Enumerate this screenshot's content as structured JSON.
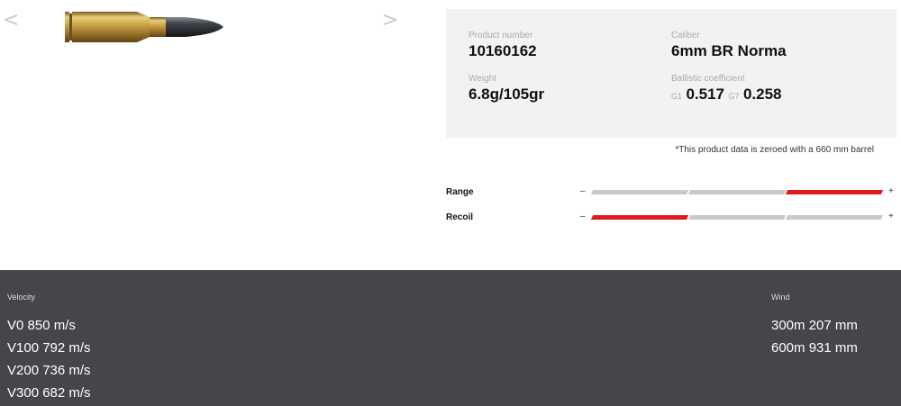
{
  "gallery": {
    "prev_glyph": "<",
    "next_glyph": ">",
    "image_icon": "cartridge-image"
  },
  "specs": {
    "product_number_label": "Product number",
    "product_number": "10160162",
    "caliber_label": "Caliber",
    "caliber": "6mm BR Norma",
    "weight_label": "Weight",
    "weight": "6.8g/105gr",
    "bc_label": "Ballistic coefficient",
    "bc_g1_prefix": "G1",
    "bc_g1": "0.517",
    "bc_g7_prefix": "G7",
    "bc_g7": "0.258",
    "note": "*This product data is zeroed with a 660 mm barrel"
  },
  "meters": {
    "range": {
      "label": "Range",
      "minus": "–",
      "plus": "+",
      "level": 3,
      "max": 3
    },
    "recoil": {
      "label": "Recoil",
      "minus": "–",
      "plus": "+",
      "level": 1,
      "max": 3
    },
    "active_color": "#e0191b",
    "inactive_color": "#c9c9c9"
  },
  "ballistics": {
    "velocity_heading": "Velocity",
    "velocity": [
      "V0 850 m/s",
      "V100 792 m/s",
      "V200 736 m/s",
      "V300 682 m/s"
    ],
    "wind_heading": "Wind",
    "wind": [
      "300m 207 mm",
      "600m 931 mm"
    ],
    "background_color": "#454649"
  }
}
